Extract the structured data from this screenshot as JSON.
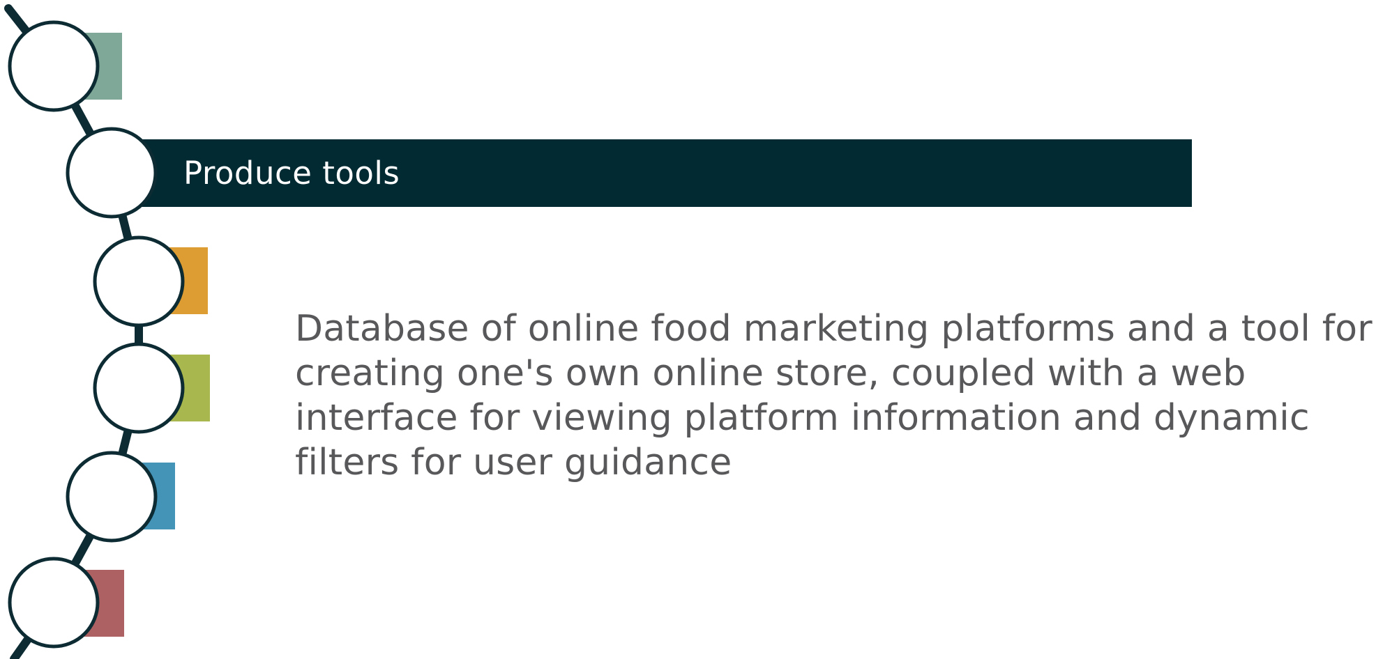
{
  "diagram": {
    "active_step_label": "Produce tools",
    "description": "Database of online food marketing platforms and a tool for creating one's own online store, coupled with a web interface for viewing platform information and dynamic filters for user guidance",
    "colors": {
      "chain": "#0c2b33",
      "active_bar": "#022a32",
      "circle_fill": "#ffffff",
      "text": "#58585a",
      "tabs": [
        "#7fa898",
        "#022a32",
        "#de9d32",
        "#a9b84e",
        "#4494b8",
        "#ad6162"
      ]
    },
    "steps": [
      {
        "tab_color": "#7fa898",
        "active": false
      },
      {
        "tab_color": "#022a32",
        "active": true
      },
      {
        "tab_color": "#de9d32",
        "active": false
      },
      {
        "tab_color": "#a9b84e",
        "active": false
      },
      {
        "tab_color": "#4494b8",
        "active": false
      },
      {
        "tab_color": "#ad6162",
        "active": false
      }
    ]
  }
}
